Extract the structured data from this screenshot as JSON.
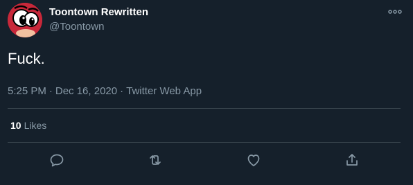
{
  "author": {
    "display_name": "Toontown Rewritten",
    "handle": "@Toontown"
  },
  "tweet": {
    "text": "Fuck.",
    "time": "5:25 PM",
    "separator_1": "·",
    "date": "Dec 16, 2020",
    "separator_2": "·",
    "source": "Twitter Web App"
  },
  "stats": {
    "likes_count": "10",
    "likes_label": "Likes"
  },
  "icons": {
    "more": "more-horizontal-icon",
    "reply": "reply-icon",
    "retweet": "retweet-icon",
    "like": "heart-icon",
    "share": "share-icon"
  },
  "colors": {
    "background": "#15202b",
    "primary_text": "#ffffff",
    "secondary_text": "#8899a6",
    "divider": "#38444d",
    "avatar_bg": "#c8283a"
  }
}
